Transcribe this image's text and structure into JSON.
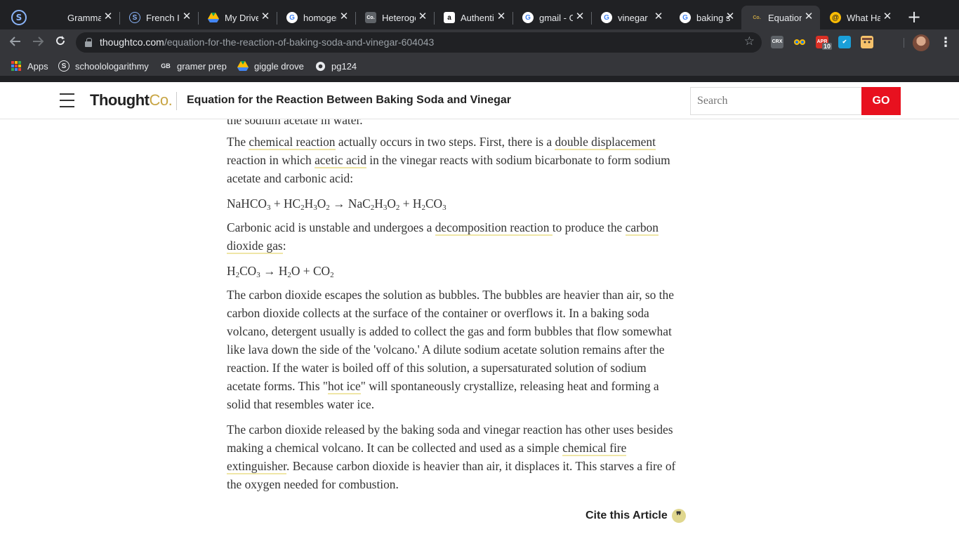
{
  "browser": {
    "profile_icon": "S",
    "tabs": [
      {
        "title": "Grammar",
        "favicon": "blank",
        "active": false
      },
      {
        "title": "French I",
        "favicon": "schoology",
        "active": false
      },
      {
        "title": "My Drive",
        "favicon": "google-drive",
        "active": false
      },
      {
        "title": "homogeneous",
        "favicon": "google",
        "active": false
      },
      {
        "title": "Heterogeneous",
        "favicon": "thoughtco",
        "active": false
      },
      {
        "title": "Authentic",
        "favicon": "amazon",
        "active": false
      },
      {
        "title": "gmail - G",
        "favicon": "google",
        "active": false
      },
      {
        "title": "vinegar",
        "favicon": "google",
        "active": false
      },
      {
        "title": "baking s",
        "favicon": "google",
        "active": false
      },
      {
        "title": "Equation",
        "favicon": "thoughtco",
        "active": true
      },
      {
        "title": "What Ha",
        "favicon": "yellow-spiral",
        "active": false
      }
    ],
    "new_tab_label": "+",
    "favicon_text": {
      "thoughtco": "Co.",
      "amazon": "a",
      "google": "G",
      "schoology": "S",
      "yellow-spiral": "@",
      "close": "✕"
    },
    "url": {
      "host": "thoughtco.com",
      "path": "/equation-for-the-reaction-of-baking-soda-and-vinegar-604043"
    },
    "extensions": {
      "crx": "CRX",
      "apr": "APR",
      "apr_badge": "10"
    },
    "bookmarks": [
      {
        "label": "Apps",
        "icon": "apps-grid-icon"
      },
      {
        "label": "schoolologarithmy",
        "icon": "schoology-icon",
        "icon_text": "S"
      },
      {
        "label": "gramer prep",
        "icon": "gb-icon",
        "icon_text": "GB"
      },
      {
        "label": "giggle drove",
        "icon": "google-drive-icon"
      },
      {
        "label": "pg124",
        "icon": "globe-icon"
      }
    ]
  },
  "site": {
    "logo_main": "Thought",
    "logo_accent": "Co.",
    "header_title": "Equation for the Reaction Between Baking Soda and Vinegar",
    "search_placeholder": "Search",
    "go_label": "GO",
    "cite_label": "Cite this Article",
    "cite_icon": "❞"
  },
  "article": {
    "partial_line": "the sodium acetate in water.",
    "p1": {
      "a": "The ",
      "l1": "chemical reaction",
      "b": " actually occurs in two steps. First, there is a ",
      "l2": "double displacement ",
      "c": "reaction in which ",
      "l3": "acetic acid",
      "d": " in the vinegar reacts with sodium bicarbonate to form sodium acetate and carbonic acid:"
    },
    "eq1": {
      "t1": "NaHCO",
      "s1": "3",
      "t2": " + HC",
      "s2": "2",
      "t3": "H",
      "s3": "3",
      "t4": "O",
      "s4": "2",
      "t5": " → NaC",
      "s5": "2",
      "t6": "H",
      "s6": "3",
      "t7": "O",
      "s7": "2",
      "t8": " + H",
      "s8": "2",
      "t9": "CO",
      "s9": "3"
    },
    "p2": {
      "a": "Carbonic acid is unstable and undergoes a ",
      "l1": "decomposition reaction ",
      "b": "to produce the ",
      "l2": "carbon dioxide gas",
      "c": ":"
    },
    "eq2": {
      "t1": "H",
      "s1": "2",
      "t2": "CO",
      "s2": "3",
      "t3": " → H",
      "s3": "2",
      "t4": "O + CO",
      "s4": "2"
    },
    "p3": {
      "a": "The carbon dioxide escapes the solution as bubbles. The bubbles are heavier than air, so the carbon dioxide collects at the surface of the container or overflows it. In a baking soda volcano, detergent usually is added to collect the gas and form bubbles that flow somewhat like lava down the side of the 'volcano.' A dilute sodium acetate solution remains after the reaction. If the water is boiled off of this solution, a supersaturated solution of sodium acetate forms. This \"",
      "l1": "hot ice",
      "b": "\" will spontaneously crystallize, releasing heat and forming a solid that resembles water ice."
    },
    "p4": {
      "a": "The carbon dioxide released by the baking soda and vinegar reaction has other uses besides making a chemical volcano. It can be collected and used as a simple ",
      "l1": "chemical fire extinguisher",
      "b": ". Because carbon dioxide is heavier than air, it displaces it. This starves a fire of the oxygen needed for combustion."
    }
  }
}
